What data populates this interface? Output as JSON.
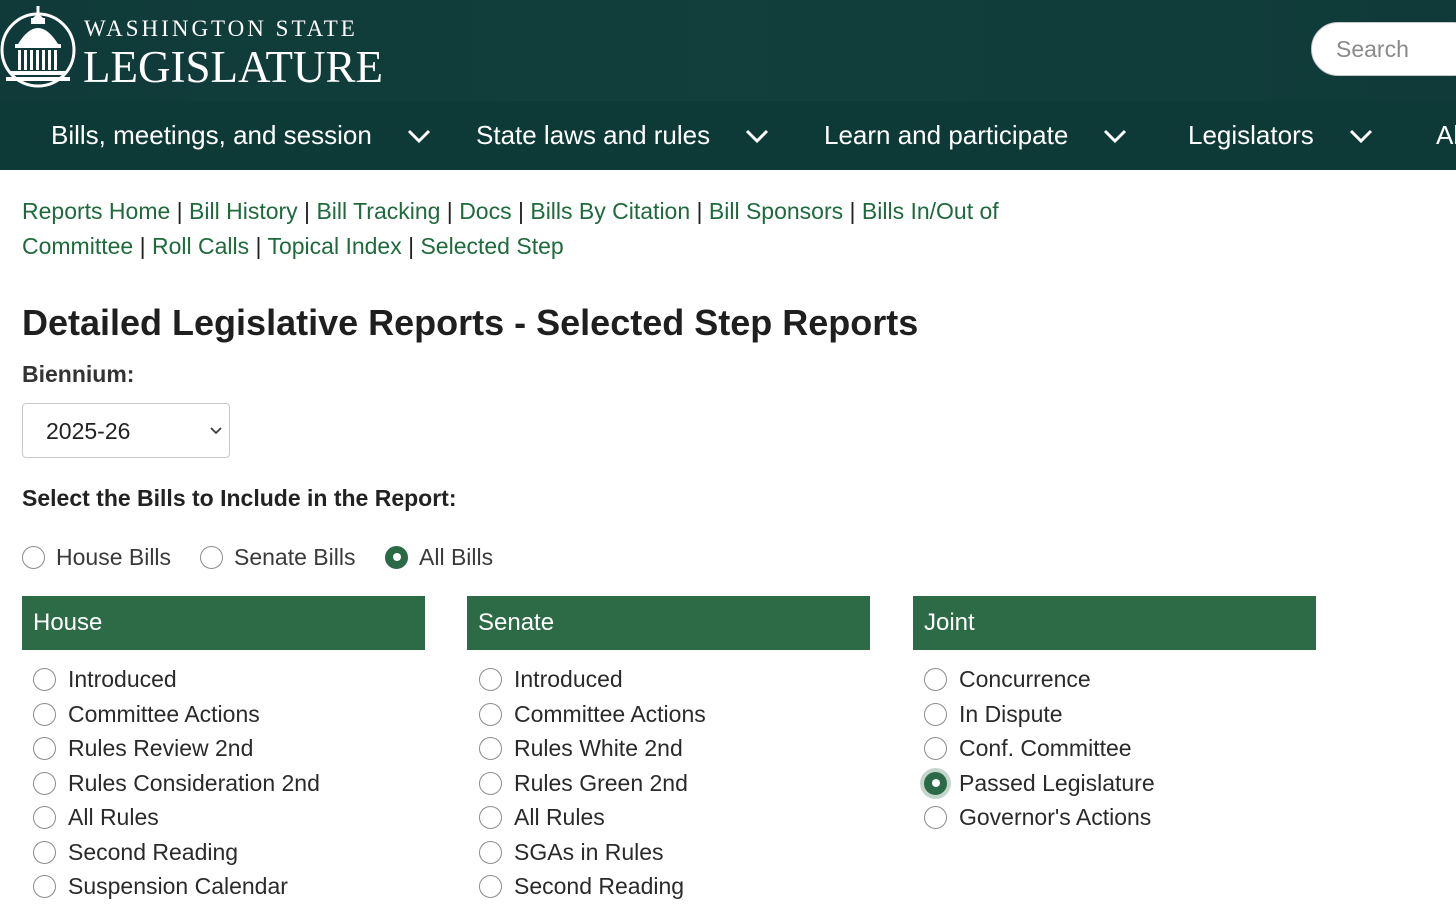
{
  "header": {
    "brand_line1": "WASHINGTON STATE",
    "brand_line2": "LEGISLATURE",
    "logo_icon": "capitol-dome-icon",
    "search_placeholder": "Search",
    "colors": {
      "header_bg": "#0f3a39",
      "nav_bg": "#0d3a36",
      "accent": "#2d6b46",
      "link": "#1e6a3c"
    }
  },
  "nav": {
    "items": [
      {
        "label": "Bills, meetings, and session"
      },
      {
        "label": "State laws and rules"
      },
      {
        "label": "Learn and participate"
      },
      {
        "label": "Legislators"
      },
      {
        "label": "Al"
      }
    ]
  },
  "report_links": [
    "Reports Home",
    "Bill History",
    "Bill Tracking",
    "Docs",
    "Bills By Citation",
    "Bill Sponsors",
    "Bills In/Out of",
    "Committee",
    "Roll Calls",
    "Topical Index",
    "Selected Step"
  ],
  "page_title": "Detailed Legislative Reports - Selected Step Reports",
  "biennium": {
    "label": "Biennium:",
    "selected": "2025-26"
  },
  "bill_select": {
    "label": "Select the Bills to Include in the Report:",
    "options": [
      {
        "label": "House Bills",
        "checked": false
      },
      {
        "label": "Senate Bills",
        "checked": false
      },
      {
        "label": "All Bills",
        "checked": true
      }
    ]
  },
  "panels": {
    "house": {
      "title": "House",
      "options": [
        "Introduced",
        "Committee Actions",
        "Rules Review 2nd",
        "Rules Consideration 2nd",
        "All Rules",
        "Second Reading",
        "Suspension Calendar"
      ]
    },
    "senate": {
      "title": "Senate",
      "options": [
        "Introduced",
        "Committee Actions",
        "Rules White 2nd",
        "Rules Green 2nd",
        "All Rules",
        "SGAs in Rules",
        "Second Reading"
      ]
    },
    "joint": {
      "title": "Joint",
      "options": [
        "Concurrence",
        "In Dispute",
        "Conf. Committee",
        "Passed Legislature",
        "Governor's Actions"
      ],
      "selected": "Passed Legislature"
    }
  }
}
